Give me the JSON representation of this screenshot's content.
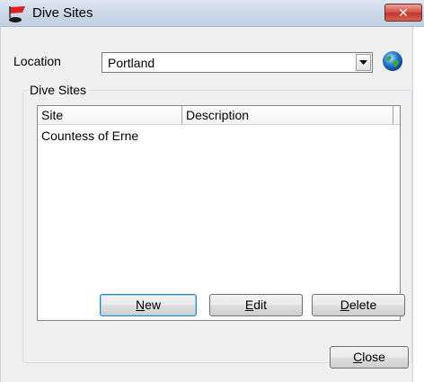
{
  "window": {
    "title": "Dive Sites",
    "close_glyph": "✕"
  },
  "location": {
    "label": "Location",
    "selected": "Portland"
  },
  "group": {
    "title": "Dive Sites"
  },
  "list": {
    "columns": [
      "Site",
      "Description"
    ],
    "rows": [
      {
        "site": "Countess of Erne",
        "description": ""
      }
    ]
  },
  "buttons": {
    "new_prefix": "",
    "new_accel": "N",
    "new_rest": "ew",
    "edit_accel": "E",
    "edit_rest": "dit",
    "delete_accel": "D",
    "delete_rest": "elete",
    "close_accel": "C",
    "close_rest": "lose"
  },
  "icons": {
    "app": "dive-flag-icon",
    "globe": "globe-icon",
    "dropdown": "chevron-down-icon"
  },
  "colors": {
    "dive_flag_red": "#e02020",
    "close_button": "#c0382a"
  }
}
